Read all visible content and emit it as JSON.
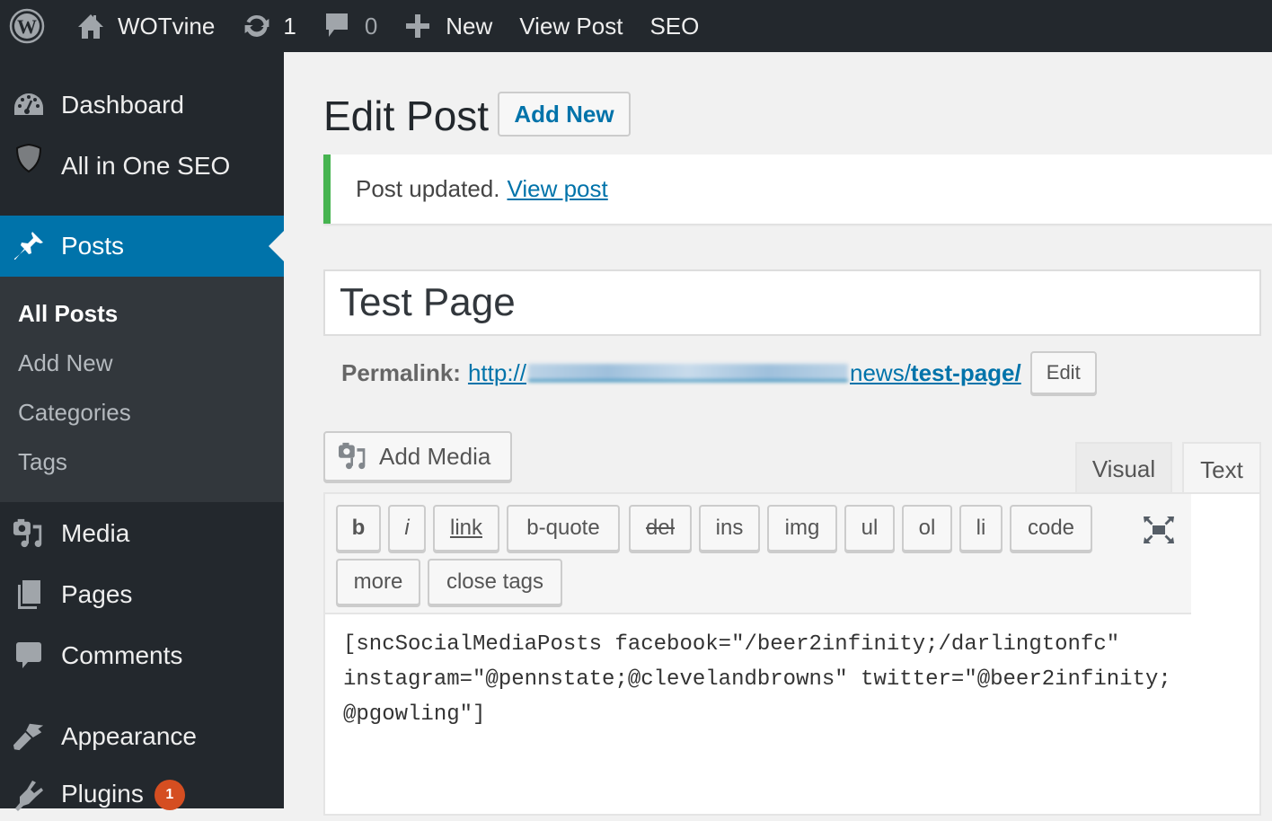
{
  "adminbar": {
    "site_name": "WOTvine",
    "updates_count": "1",
    "comments_count": "0",
    "new_label": "New",
    "view_post_label": "View Post",
    "seo_label": "SEO"
  },
  "sidebar": {
    "items": [
      {
        "label": "Dashboard",
        "icon": "dashboard-icon"
      },
      {
        "label": "All in One SEO",
        "icon": "shield-icon"
      },
      {
        "label": "Posts",
        "icon": "pin-icon",
        "current": true
      },
      {
        "label": "Media",
        "icon": "media-icon"
      },
      {
        "label": "Pages",
        "icon": "pages-icon"
      },
      {
        "label": "Comments",
        "icon": "comment-icon"
      },
      {
        "label": "Appearance",
        "icon": "brush-icon"
      },
      {
        "label": "Plugins",
        "icon": "plugin-icon",
        "badge": "1"
      }
    ],
    "submenu": [
      {
        "label": "All Posts",
        "current": true
      },
      {
        "label": "Add New"
      },
      {
        "label": "Categories"
      },
      {
        "label": "Tags"
      }
    ]
  },
  "main": {
    "page_title": "Edit Post",
    "add_new_label": "Add New",
    "notice": {
      "text": "Post updated.",
      "link_label": "View post",
      "color": "#46b450"
    },
    "post_title": "Test Page",
    "permalink": {
      "label": "Permalink:",
      "url_prefix": "http://",
      "url_suffix": "news/",
      "slug": "test-page/",
      "edit_label": "Edit"
    },
    "add_media_label": "Add Media",
    "tabs": [
      {
        "label": "Visual"
      },
      {
        "label": "Text",
        "active": true
      }
    ],
    "quicktags": [
      "b",
      "i",
      "link",
      "b-quote",
      "del",
      "ins",
      "img",
      "ul",
      "ol",
      "li",
      "code",
      "more",
      "close tags"
    ],
    "content": "[sncSocialMediaPosts facebook=\"/beer2infinity;/darlingtonfc\"\ninstagram=\"@pennstate;@clevelandbrowns\" twitter=\"@beer2infinity;\n@pgowling\"]"
  },
  "colors": {
    "accent": "#0073aa",
    "adminbar_bg": "#23282d",
    "submenu_bg": "#32373c",
    "badge": "#d54e21"
  }
}
